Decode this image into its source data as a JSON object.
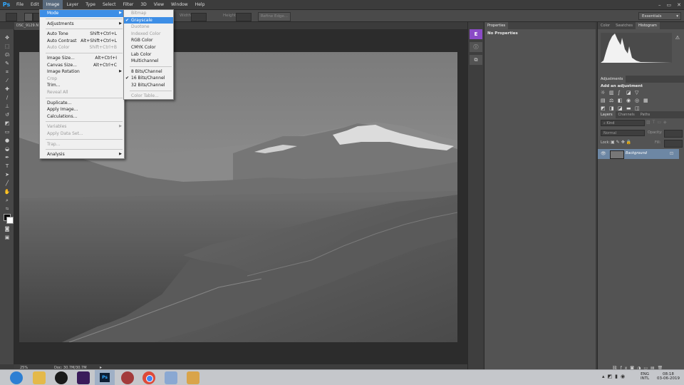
{
  "app": {
    "logo": "Ps"
  },
  "menubar": {
    "items": [
      "File",
      "Edit",
      "Image",
      "Layer",
      "Type",
      "Select",
      "Filter",
      "3D",
      "View",
      "Window",
      "Help"
    ],
    "active_index": 2
  },
  "window_controls": [
    "–",
    "▭",
    "✕"
  ],
  "options": {
    "width_label": "Width:",
    "height_label": "Height:",
    "refine_edge": "Refine Edge...",
    "workspace": "Essentials"
  },
  "document": {
    "tab": "DSC_9129.N",
    "zoom": "25%",
    "doc_size": "Doc: 30.7M/30.7M"
  },
  "image_menu": {
    "items": [
      {
        "label": "Mode",
        "shortcut": "",
        "submenu": true,
        "highlight": true,
        "disabled": false
      },
      {
        "sep": true
      },
      {
        "label": "Adjustments",
        "shortcut": "",
        "submenu": true,
        "disabled": false
      },
      {
        "sep": true
      },
      {
        "label": "Auto Tone",
        "shortcut": "Shift+Ctrl+L",
        "disabled": false
      },
      {
        "label": "Auto Contrast",
        "shortcut": "Alt+Shift+Ctrl+L",
        "disabled": false
      },
      {
        "label": "Auto Color",
        "shortcut": "Shift+Ctrl+B",
        "disabled": true
      },
      {
        "sep": true
      },
      {
        "label": "Image Size...",
        "shortcut": "Alt+Ctrl+I",
        "disabled": false
      },
      {
        "label": "Canvas Size...",
        "shortcut": "Alt+Ctrl+C",
        "disabled": false
      },
      {
        "label": "Image Rotation",
        "shortcut": "",
        "submenu": true,
        "disabled": false
      },
      {
        "label": "Crop",
        "shortcut": "",
        "disabled": true
      },
      {
        "label": "Trim...",
        "shortcut": "",
        "disabled": false
      },
      {
        "label": "Reveal All",
        "shortcut": "",
        "disabled": true
      },
      {
        "sep": true
      },
      {
        "label": "Duplicate...",
        "shortcut": "",
        "disabled": false
      },
      {
        "label": "Apply Image...",
        "shortcut": "",
        "disabled": false
      },
      {
        "label": "Calculations...",
        "shortcut": "",
        "disabled": false
      },
      {
        "sep": true
      },
      {
        "label": "Variables",
        "shortcut": "",
        "submenu": true,
        "disabled": true
      },
      {
        "label": "Apply Data Set...",
        "shortcut": "",
        "disabled": true
      },
      {
        "sep": true
      },
      {
        "label": "Trap...",
        "shortcut": "",
        "disabled": true
      },
      {
        "sep": true
      },
      {
        "label": "Analysis",
        "shortcut": "",
        "submenu": true,
        "disabled": false
      }
    ]
  },
  "mode_menu": {
    "items": [
      {
        "label": "Bitmap",
        "disabled": true
      },
      {
        "label": "Grayscale",
        "checked": true,
        "highlight": true
      },
      {
        "label": "Duotone",
        "disabled": true
      },
      {
        "label": "Indexed Color",
        "disabled": true
      },
      {
        "label": "RGB Color"
      },
      {
        "label": "CMYK Color"
      },
      {
        "label": "Lab Color"
      },
      {
        "label": "Multichannel"
      },
      {
        "sep": true
      },
      {
        "label": "8 Bits/Channel"
      },
      {
        "label": "16 Bits/Channel",
        "checked": true
      },
      {
        "label": "32 Bits/Channel"
      },
      {
        "sep": true
      },
      {
        "label": "Color Table...",
        "disabled": true
      }
    ]
  },
  "properties_panel": {
    "tab": "Properties",
    "content": "No Properties"
  },
  "color_panel": {
    "tabs": [
      "Color",
      "Swatches",
      "Histogram"
    ],
    "active": 2
  },
  "adjustments_panel": {
    "tab": "Adjustments",
    "subtitle": "Add an adjustment"
  },
  "layers_panel": {
    "tabs": [
      "Layers",
      "Channels",
      "Paths"
    ],
    "filter": "Kind",
    "blend_mode": "Normal",
    "opacity_label": "Opacity:",
    "lock_label": "Lock:",
    "fill_label": "Fill:",
    "layer_name": "Background"
  },
  "taskbar": {
    "language": "ENG",
    "layout": "INTL",
    "time": "08:18",
    "date": "03-06-2019"
  }
}
